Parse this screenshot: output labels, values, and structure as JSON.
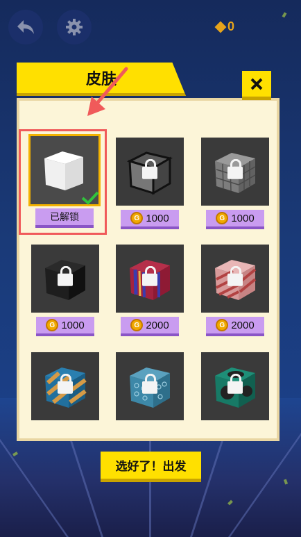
{
  "header": {
    "coins_value": "0"
  },
  "panel": {
    "title": "皮肤"
  },
  "skins": [
    {
      "name": "white-cube",
      "state": "已解锁",
      "selected": true
    },
    {
      "name": "glass-cube",
      "price": "1000"
    },
    {
      "name": "stone-cube",
      "price": "1000"
    },
    {
      "name": "black-cube",
      "price": "1000"
    },
    {
      "name": "stripe-red-purple-cube",
      "price": "2000"
    },
    {
      "name": "candy-stripe-cube",
      "price": "2000"
    },
    {
      "name": "blue-orange-stripe-cube"
    },
    {
      "name": "blue-pattern-cube"
    },
    {
      "name": "teal-spot-cube"
    }
  ],
  "currency_symbol": "G",
  "start_button": {
    "label": "选好了！出发"
  }
}
